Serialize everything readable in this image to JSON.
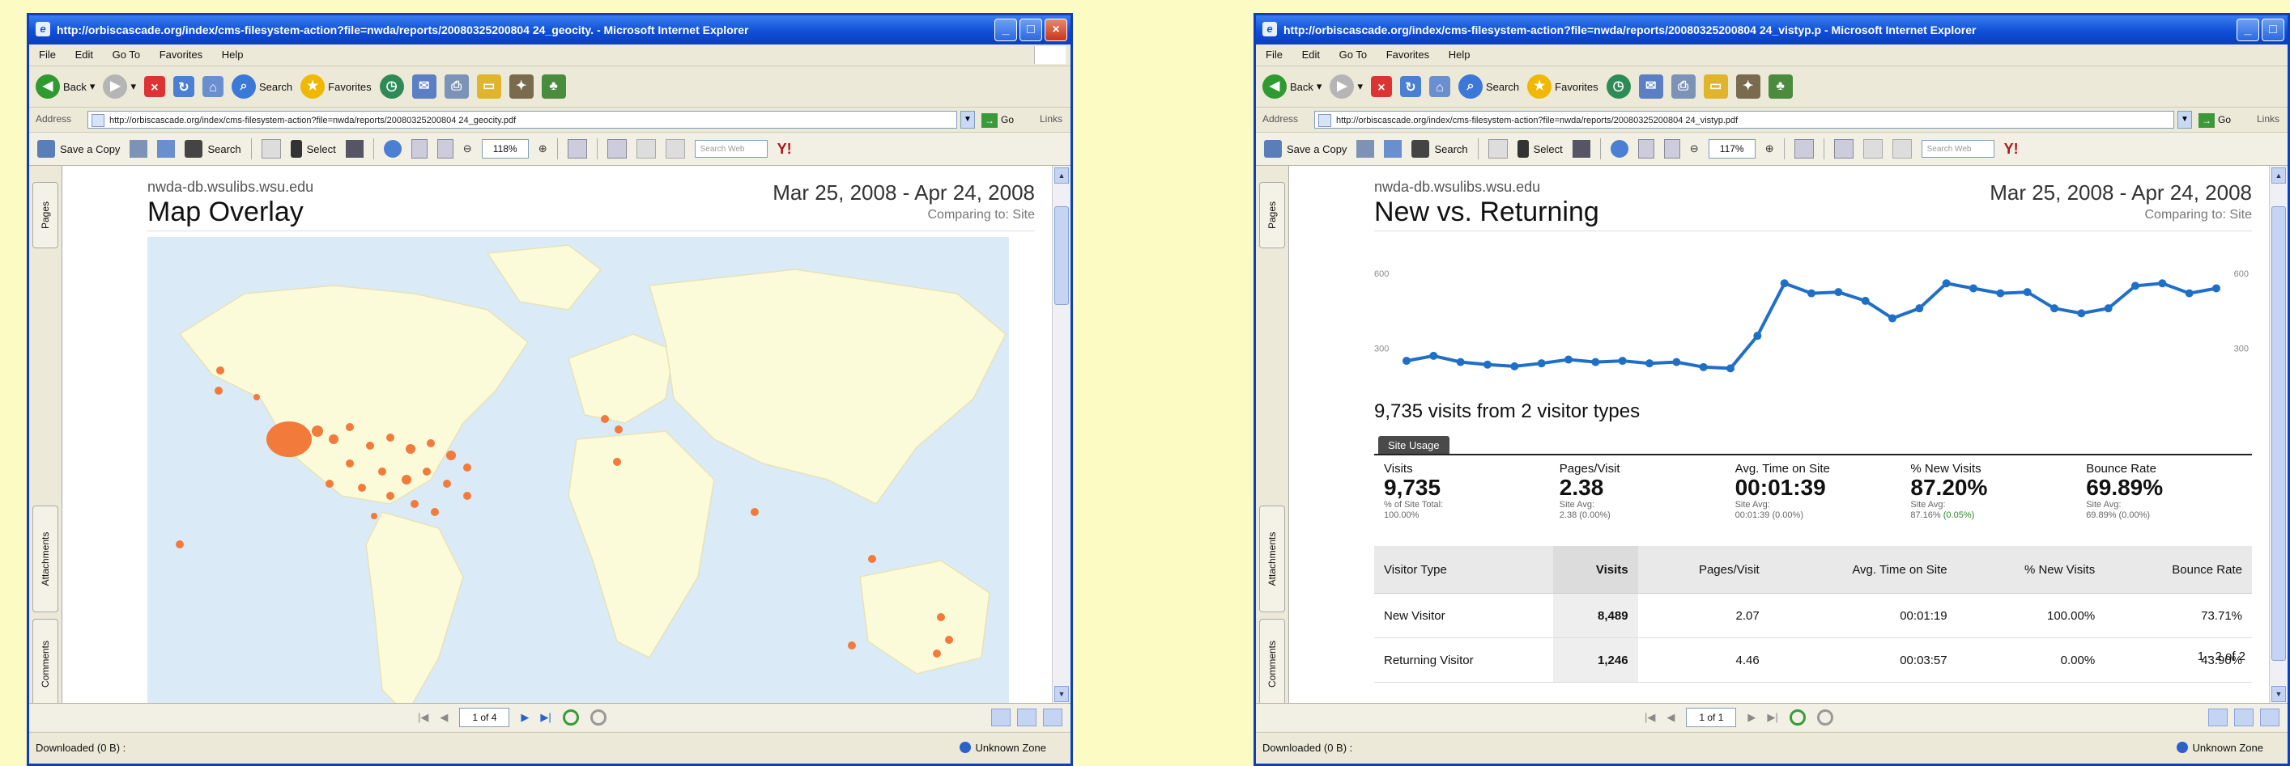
{
  "colors": {
    "accent": "#0a3fbf",
    "map_dot": "#f27a3a",
    "trend_line": "#1f6fc7",
    "page_bg": "#fdfbc4"
  },
  "left_window": {
    "title": "http://orbiscascade.org/index/cms-filesystem-action?file=nwda/reports/20080325200804 24_geocity. - Microsoft Internet Explorer",
    "menu": [
      "File",
      "Edit",
      "Go To",
      "Favorites",
      "Help"
    ],
    "toolbar": {
      "back": "Back",
      "search": "Search",
      "favorites": "Favorites"
    },
    "address_label": "Address",
    "address": "http://orbiscascade.org/index/cms-filesystem-action?file=nwda/reports/20080325200804 24_geocity.pdf",
    "go": "Go",
    "links": "Links",
    "pdf_toolbar": {
      "save": "Save a Copy",
      "search": "Search",
      "select": "Select",
      "zoom": "118%",
      "search_web": "Search Web"
    },
    "side_tabs": [
      "Pages",
      "Attachments",
      "Comments"
    ],
    "report": {
      "site": "nwda-db.wsulibs.wsu.edu",
      "title": "Map Overlay",
      "date_range": "Mar 25, 2008 - Apr 24, 2008",
      "comparing": "Comparing to: Site"
    },
    "nav": {
      "page": "1 of 4"
    },
    "status": {
      "left": "Downloaded (0 B) :",
      "right": "Unknown Zone"
    }
  },
  "right_window": {
    "title": "http://orbiscascade.org/index/cms-filesystem-action?file=nwda/reports/20080325200804 24_vistyp.p - Microsoft Internet Explorer",
    "menu": [
      "File",
      "Edit",
      "Go To",
      "Favorites",
      "Help"
    ],
    "toolbar": {
      "back": "Back",
      "search": "Search",
      "favorites": "Favorites"
    },
    "address_label": "Address",
    "address": "http://orbiscascade.org/index/cms-filesystem-action?file=nwda/reports/20080325200804 24_vistyp.pdf",
    "go": "Go",
    "links": "Links",
    "pdf_toolbar": {
      "save": "Save a Copy",
      "search": "Search",
      "select": "Select",
      "zoom": "117%",
      "search_web": "Search Web"
    },
    "side_tabs": [
      "Pages",
      "Attachments",
      "Comments"
    ],
    "report": {
      "site": "nwda-db.wsulibs.wsu.edu",
      "title": "New vs. Returning",
      "date_range": "Mar 25, 2008 - Apr 24, 2008",
      "comparing": "Comparing to: Site"
    },
    "visits_title": "9,735 visits from 2 visitor types",
    "site_usage_tab": "Site Usage",
    "summary": [
      {
        "label": "Visits",
        "value": "9,735",
        "sub1": "% of Site Total:",
        "sub2": "100.00%",
        "delta": ""
      },
      {
        "label": "Pages/Visit",
        "value": "2.38",
        "sub1": "Site Avg:",
        "sub2": "2.38 (0.00%)",
        "delta": ""
      },
      {
        "label": "Avg. Time on Site",
        "value": "00:01:39",
        "sub1": "Site Avg:",
        "sub2": "00:01:39 (0.00%)",
        "delta": ""
      },
      {
        "label": "% New Visits",
        "value": "87.20%",
        "sub1": "Site Avg:",
        "sub2": "87.16%",
        "delta": "(0.05%)"
      },
      {
        "label": "Bounce Rate",
        "value": "69.89%",
        "sub1": "Site Avg:",
        "sub2": "69.89% (0.00%)",
        "delta": ""
      }
    ],
    "table": {
      "headers": [
        "Visitor Type",
        "Visits",
        "Pages/Visit",
        "Avg. Time on Site",
        "% New Visits",
        "Bounce Rate"
      ],
      "rows": [
        [
          "New Visitor",
          "8,489",
          "2.07",
          "00:01:19",
          "100.00%",
          "73.71%"
        ],
        [
          "Returning Visitor",
          "1,246",
          "4.46",
          "00:03:57",
          "0.00%",
          "43.90%"
        ]
      ]
    },
    "pager": "1 - 2 of 2",
    "nav": {
      "page": "1 of 1"
    },
    "status": {
      "left": "Downloaded (0 B) :",
      "right": "Unknown Zone"
    }
  },
  "chart_data": {
    "type": "line",
    "title": "",
    "yticks_left": [
      "600",
      "300"
    ],
    "yticks_right": [
      "600",
      "300"
    ],
    "ylim": [
      150,
      700
    ],
    "values": [
      250,
      270,
      245,
      235,
      228,
      240,
      255,
      245,
      250,
      240,
      245,
      225,
      220,
      350,
      560,
      520,
      525,
      490,
      420,
      460,
      560,
      540,
      520,
      525,
      460,
      440,
      460,
      550,
      560,
      520,
      540
    ],
    "grid": false
  }
}
